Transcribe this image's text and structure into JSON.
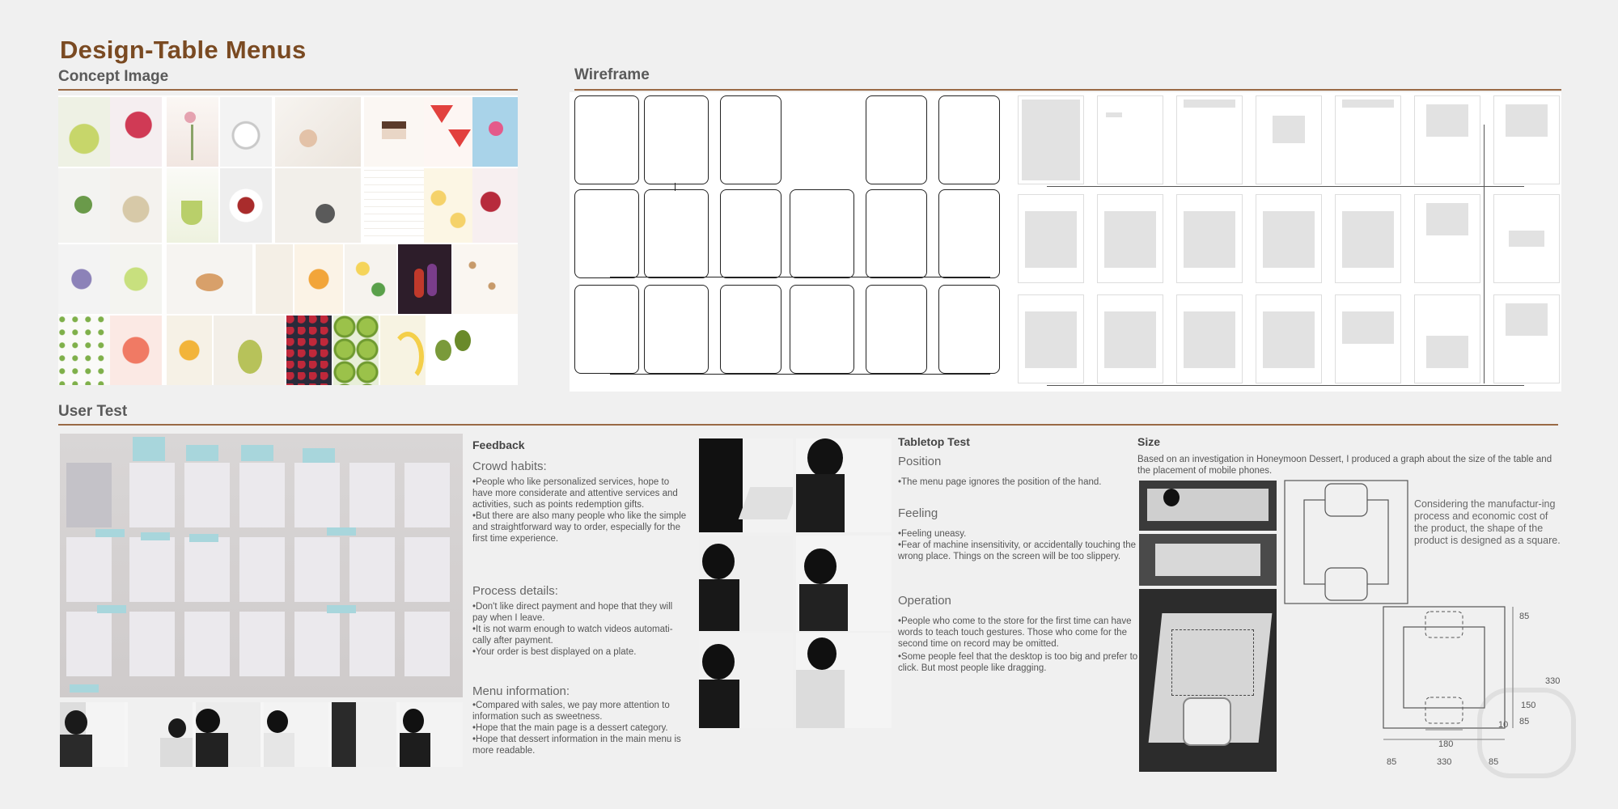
{
  "page": {
    "title": "Design-Table Menus"
  },
  "sections": {
    "concept": "Concept Image",
    "wireframe": "Wireframe",
    "usertest": "User Test"
  },
  "colors": {
    "brand": "#7a4a22",
    "rule": "#9a6a45",
    "background": "#f0f0f0"
  },
  "feedback": {
    "heading": "Feedback",
    "groups": [
      {
        "title": "Crowd habits:",
        "lines": [
          "•People who like personalized services, hope to have more considerate and attentive services and activities, such as points redemption gifts.",
          "•But there are also many people who like the simple and straightforward way to order, especially for the first time experience."
        ]
      },
      {
        "title": "Process details:",
        "lines": [
          "•Don't like direct payment and hope that they will pay when I leave.",
          "•It is not warm enough to watch videos automati-cally after payment.",
          "•Your order is best displayed on a plate."
        ]
      },
      {
        "title": "Menu information:",
        "lines": [
          "•Compared with sales, we pay more attention to information such as sweetness.",
          "•Hope that the main page is a dessert category.",
          "•Hope that dessert information in the main menu is more readable."
        ]
      }
    ]
  },
  "tabletop": {
    "heading": "Tabletop Test",
    "groups": [
      {
        "title": "Position",
        "lines": [
          "•The menu page ignores the position of the hand."
        ]
      },
      {
        "title": "Feeling",
        "lines": [
          "•Feeling uneasy.",
          "•Fear of machine insensitivity, or accidentally touching the wrong place. Things on the screen will be too slippery."
        ]
      },
      {
        "title": "Operation",
        "lines": [
          "•People who come to the store for the first time can have words to teach touch gestures. Those who come for the second time on record may be omitted.",
          "•Some people feel that the desktop is too big and prefer to click. But most people like dragging."
        ]
      }
    ]
  },
  "size": {
    "heading": "Size",
    "intro": "Based on an investigation in Honeymoon Dessert, I produced a graph about the size of the table and the placement of mobile phones.",
    "note": "Considering the manufactur-ing process and economic cost of the product, the shape of the product is designed as a square.",
    "dims": {
      "d85_top": "85",
      "d330_right": "330",
      "d150": "150",
      "d85_mid": "85",
      "d10": "10",
      "d180": "180",
      "d85_left": "85",
      "d330_bottom": "330",
      "d85_right": "85"
    }
  }
}
